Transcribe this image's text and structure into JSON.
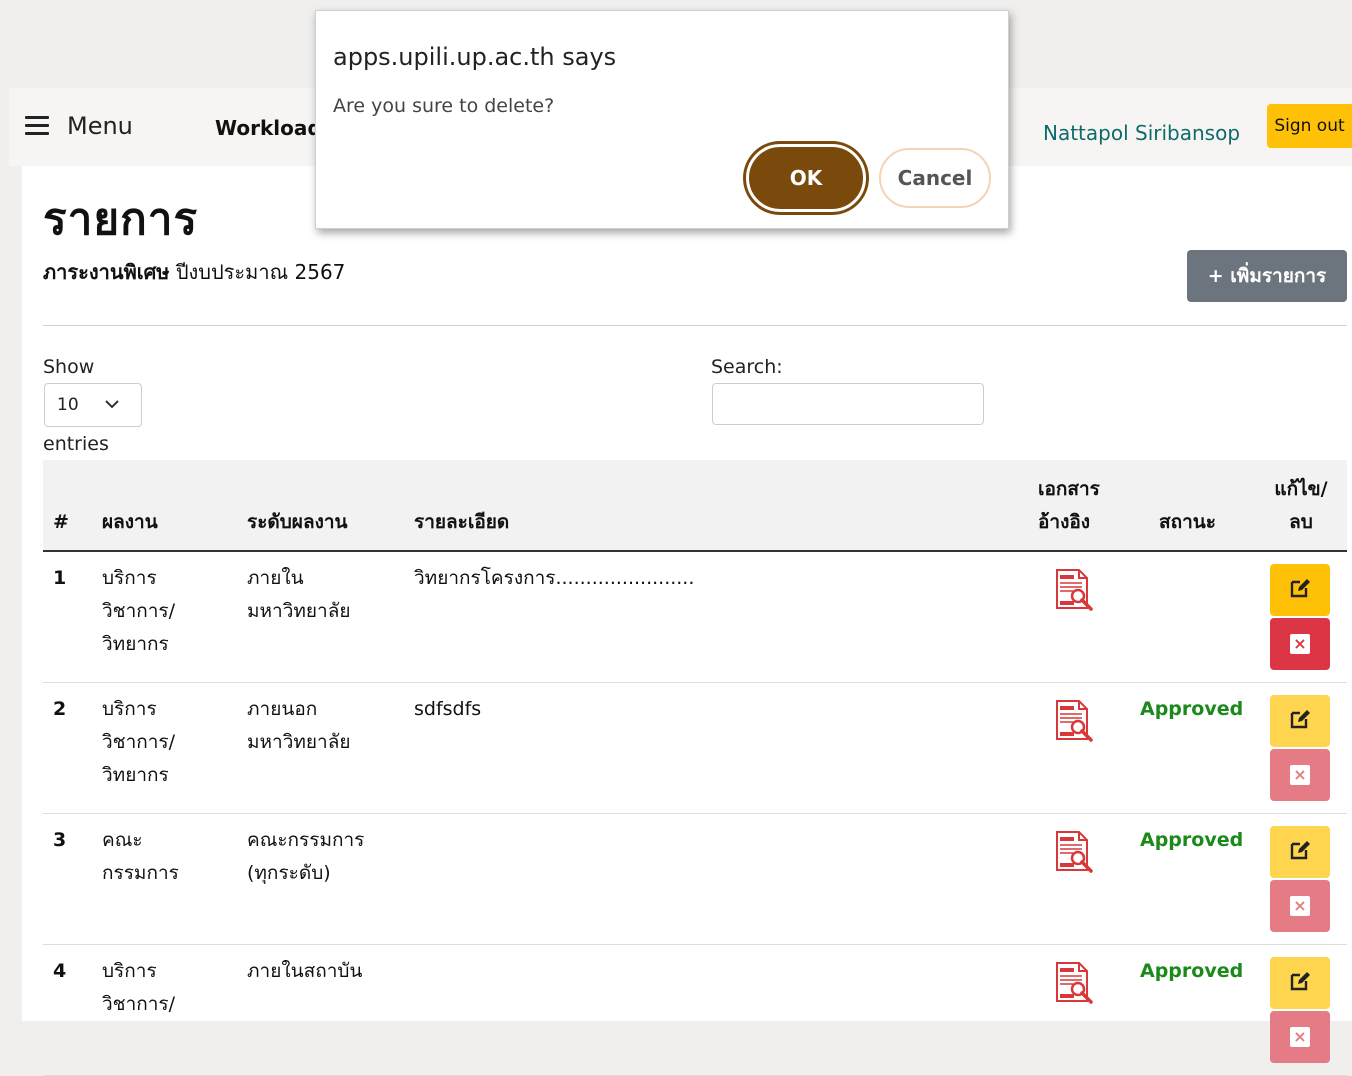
{
  "navbar": {
    "menu_label": "Menu",
    "workload_label": "Workload",
    "user_name": "Nattapol Siribansop",
    "signout_label": "Sign out"
  },
  "page": {
    "title": "รายการ",
    "subtitle_bold": "ภาระงานพิเศษ",
    "subtitle_rest": " ปีงบประมาณ 2567",
    "add_button": "+ เพิ่มรายการ"
  },
  "table_controls": {
    "show_label": "Show",
    "page_length": "10",
    "entries_label": "entries",
    "search_label": "Search:",
    "search_value": ""
  },
  "table": {
    "headers": {
      "num": "#",
      "work": "ผลงาน",
      "level": "ระดับผลงาน",
      "detail": "รายละเอียด",
      "doc_line1": "เอกสาร",
      "doc_line2": "อ้างอิง",
      "status": "สถานะ",
      "edit_line1": "แก้ไข/",
      "edit_line2": "ลบ"
    },
    "rows": [
      {
        "num": "1",
        "work": [
          "บริการ",
          "วิชาการ/",
          "วิทยากร"
        ],
        "level": [
          "ภายใน",
          "มหาวิทยาลัย"
        ],
        "detail": "วิทยากรโครงการ.......................",
        "status": ""
      },
      {
        "num": "2",
        "work": [
          "บริการ",
          "วิชาการ/",
          "วิทยากร"
        ],
        "level": [
          "ภายนอก",
          "มหาวิทยาลัย"
        ],
        "detail": "sdfsdfs",
        "status": "Approved"
      },
      {
        "num": "3",
        "work": [
          "คณะ",
          "กรรมการ",
          ""
        ],
        "level": [
          "คณะกรรมการ",
          "(ทุกระดับ)"
        ],
        "detail": "",
        "status": "Approved"
      },
      {
        "num": "4",
        "work": [
          "บริการ",
          "วิชาการ/",
          ""
        ],
        "level": [
          "ภายในสถาบัน",
          ""
        ],
        "detail": "",
        "status": "Approved"
      }
    ]
  },
  "dialog": {
    "title": "apps.upili.up.ac.th says",
    "message": "Are you sure to delete?",
    "ok_label": "OK",
    "cancel_label": "Cancel"
  },
  "colors": {
    "accent_yellow": "#ffc107",
    "danger_red": "#dc3545",
    "ok_brown": "#7a4a0c",
    "approved_green": "#1b8a1b",
    "user_teal": "#0f6b6a"
  },
  "icons": {
    "menu": "hamburger-icon",
    "document": "pdf-search-icon",
    "edit": "edit-icon",
    "delete": "close-icon",
    "dropdown": "chevron-down-icon"
  }
}
